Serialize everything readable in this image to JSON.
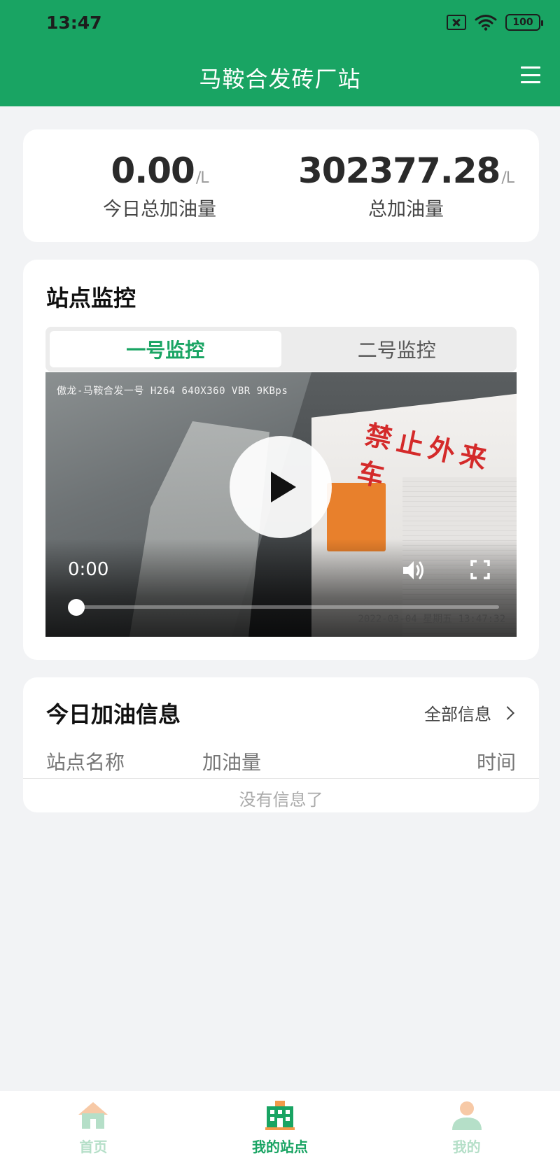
{
  "status_bar": {
    "time": "13:47",
    "battery": "100",
    "icons": [
      "sim-off-icon",
      "wifi-icon",
      "battery-icon"
    ]
  },
  "header": {
    "title": "马鞍合发砖厂站",
    "menu_icon": "menu-icon",
    "background": "#19a463"
  },
  "stats": {
    "today": {
      "value": "0.00",
      "unit": "/L",
      "label": "今日总加油量"
    },
    "total": {
      "value": "302377.28",
      "unit": "/L",
      "label": "总加油量"
    }
  },
  "monitor": {
    "title": "站点监控",
    "tabs": [
      {
        "label": "一号监控",
        "active": true
      },
      {
        "label": "二号监控",
        "active": false
      }
    ],
    "video": {
      "overlay_text": "傲龙-马鞍合发一号 H264 640X360 VBR 9KBps",
      "sign_text": "禁止外来车",
      "date_stamp": "2022-03-04 星期五 13:47:32",
      "current_time": "0:00",
      "progress": 0
    }
  },
  "fuel_info": {
    "title": "今日加油信息",
    "all_info_label": "全部信息",
    "columns": [
      "站点名称",
      "加油量",
      "时间"
    ],
    "rows": [],
    "empty_text": "没有信息了"
  },
  "bottom_nav": {
    "items": [
      {
        "label": "首页",
        "icon": "home-icon",
        "active": false
      },
      {
        "label": "我的站点",
        "icon": "building-icon",
        "active": true
      },
      {
        "label": "我的",
        "icon": "user-icon",
        "active": false
      }
    ],
    "active_color": "#19a463",
    "inactive_color": "#b5dfc8"
  }
}
